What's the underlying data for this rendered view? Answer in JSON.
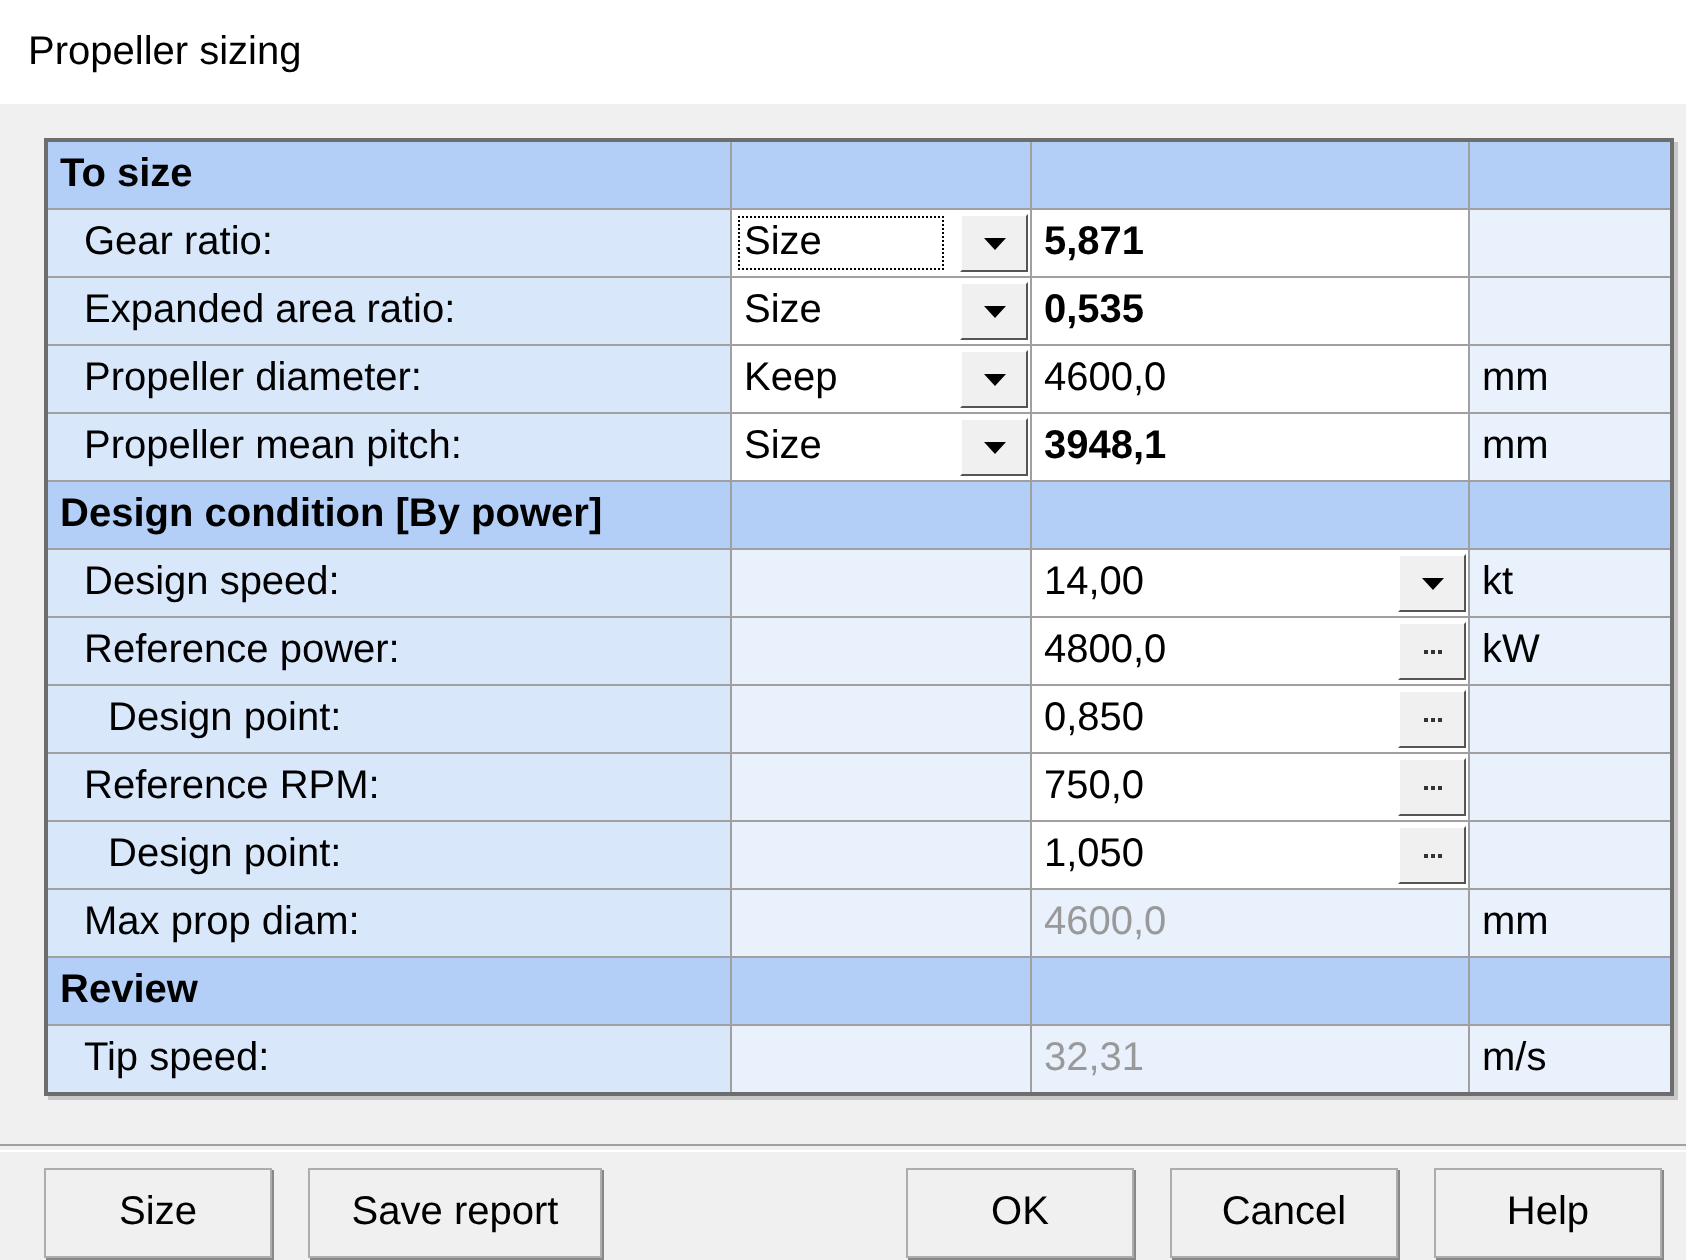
{
  "window": {
    "title": "Propeller sizing"
  },
  "sections": [
    {
      "title": "To size",
      "rows": [
        {
          "kind": "choice",
          "label": "Gear ratio:",
          "mode": {
            "value": "Size",
            "focused": true
          },
          "value": {
            "text": "5,871",
            "bold": true,
            "editable": true
          }
        },
        {
          "kind": "choice",
          "label": "Expanded area ratio:",
          "mode": {
            "value": "Size",
            "focused": false
          },
          "value": {
            "text": "0,535",
            "bold": true,
            "editable": true
          }
        },
        {
          "kind": "choice",
          "label": "Propeller diameter:",
          "mode": {
            "value": "Keep",
            "focused": false
          },
          "value": {
            "text": "4600,0",
            "bold": false,
            "editable": true
          },
          "unit": "mm"
        },
        {
          "kind": "choice",
          "label": "Propeller mean pitch:",
          "mode": {
            "value": "Size",
            "focused": false
          },
          "value": {
            "text": "3948,1",
            "bold": true,
            "editable": true
          },
          "unit": "mm"
        }
      ]
    },
    {
      "title": "Design condition [By power]",
      "rows": [
        {
          "kind": "dropdown",
          "label": "Design speed:",
          "value": {
            "text": "14,00",
            "bold": false,
            "editable": true
          },
          "unit": "kt"
        },
        {
          "kind": "browse",
          "label": "Reference power:",
          "value": {
            "text": "4800,0",
            "bold": false,
            "editable": true
          },
          "unit": "kW",
          "children": [
            {
              "kind": "browse",
              "label": "Design point:",
              "value": {
                "text": "0,850",
                "bold": false,
                "editable": true
              }
            }
          ]
        },
        {
          "kind": "browse",
          "label": "Reference RPM:",
          "value": {
            "text": "750,0",
            "bold": false,
            "editable": true
          },
          "children": [
            {
              "kind": "browse",
              "label": "Design point:",
              "value": {
                "text": "1,050",
                "bold": false,
                "editable": true
              }
            }
          ]
        },
        {
          "kind": "plain",
          "label": "Max prop diam:",
          "value": {
            "text": "4600,0",
            "bold": false,
            "editable": false
          },
          "unit": "mm"
        }
      ]
    },
    {
      "title": "Review",
      "rows": [
        {
          "kind": "plain",
          "label": "Tip speed:",
          "value": {
            "text": "32,31",
            "bold": false,
            "editable": false
          },
          "unit": "m/s"
        }
      ]
    }
  ],
  "left_buttons": [
    "Size",
    "Save report"
  ],
  "right_buttons": [
    "OK",
    "Cancel",
    "Help"
  ]
}
